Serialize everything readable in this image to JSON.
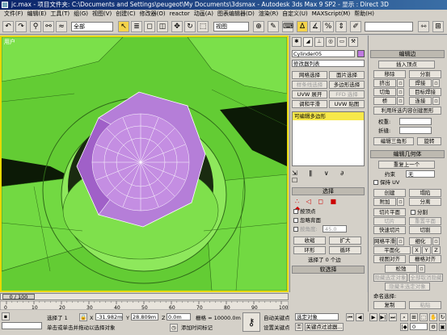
{
  "title": "jc.max  - 项目文件夹: C:\\Documents and Settings\\peugeot\\My Documents\\3dsmax   - Autodesk 3ds Max 9 SP2   - 显示 : Direct 3D",
  "menu": [
    "文件(F)",
    "编辑(E)",
    "工具(T)",
    "组(G)",
    "视图(V)",
    "创建(C)",
    "修改器(O)",
    "reactor",
    "动画(A)",
    "图表编辑器(D)",
    "渲染(R)",
    "自定义(U)",
    "MAXScript(M)",
    "帮助(H)"
  ],
  "toolbar": {
    "filter": "全部",
    "refcoord": "视图"
  },
  "viewport": {
    "label": "用户",
    "accent": "#e8d800",
    "bg": "#6fd63a"
  },
  "cmd": {
    "object_name": "Cylinder05",
    "modifier_list": "修改器列表",
    "btns": [
      "网格选择",
      "面片选择",
      "样条线选择",
      "多边形选择",
      "UVW 展开",
      "FFD 选择",
      "调和平滑",
      "UVW 贴图"
    ],
    "stack_item": "可编辑多边形",
    "sel_hdr": "选择",
    "by_vertex": "按顶点",
    "ignore_back": "忽略背面",
    "by_angle": "按角度:",
    "angle_val": "45.0",
    "shrink": "收缩",
    "grow": "扩大",
    "ring": "环形",
    "loop": "循环",
    "sel_status": "选择了 0 个边",
    "soft_sel": "软选择"
  },
  "right": {
    "edit_edges": "编辑边",
    "insert_vertex": "插入顶点",
    "remove": "移除",
    "split": "分割",
    "extrude": "挤出",
    "weld": "焊接",
    "chamfer": "切角",
    "target_weld": "目标焊接",
    "bridge": "桥",
    "connect": "连接",
    "create_shape": "利用所选内容创建图形",
    "weight": "权重:",
    "crease": "折缝:",
    "edit_tri": "编辑三角形",
    "turn": "旋转",
    "edit_geom": "编辑几何体",
    "repeat_last": "重复上一个",
    "constraints": "约束",
    "constraint_val": "无",
    "preserve_uv": "保持 UV",
    "create": "创建",
    "collapse": "塌陷",
    "attach": "附加",
    "detach": "分离",
    "slice_plane": "切片平面",
    "split2": "分割",
    "slice": "切片",
    "reset_plane": "重置平面",
    "quickslice": "快速切片",
    "cut": "切割",
    "msmooth": "网格平滑",
    "tessellate": "细化",
    "make_planar": "平面化",
    "x": "X",
    "y": "Y",
    "z": "Z",
    "view_align": "视图对齐",
    "grid_align": "栅格对齐",
    "relax": "松弛",
    "hide_sel": "隐藏选定对象",
    "unhide_all": "全部取消隐藏",
    "hide_unsel": "隐藏未选定对象",
    "named_sel": "命名选择:",
    "copy": "复制",
    "paste": "粘贴"
  },
  "timeline": {
    "frame": "0 / 100",
    "ticks": [
      "0",
      "10",
      "20",
      "30",
      "40",
      "50",
      "60",
      "70",
      "80",
      "90",
      "100"
    ]
  },
  "status": {
    "selected": "选择了 1",
    "x": "-31.982m",
    "y": "28.809m",
    "z": "0.0m",
    "grid": "栅格 = 10000.0m",
    "prompt": "单击或单击并拖动以选择对象",
    "add_time_tag": "添加时间标记",
    "autokey": "自动关键点",
    "setkey": "设置关键点",
    "sel_obj": "选定对象",
    "key_filters": "关键点过滤器...",
    "frame_val": "0"
  }
}
